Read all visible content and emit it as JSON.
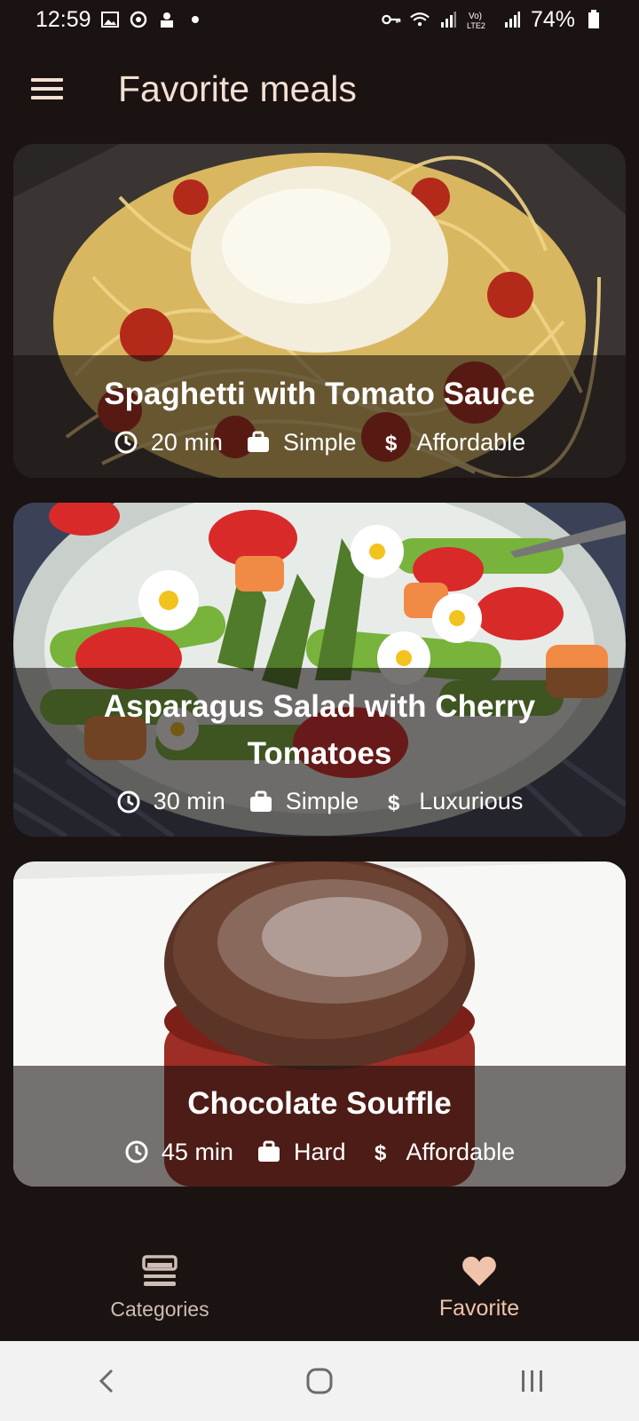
{
  "status_bar": {
    "time": "12:59",
    "battery": "74%"
  },
  "app_bar": {
    "title": "Favorite meals"
  },
  "meals": [
    {
      "title": "Spaghetti with Tomato Sauce",
      "duration": "20 min",
      "complexity": "Simple",
      "affordability": "Affordable"
    },
    {
      "title": "Asparagus Salad with Cherry Tomatoes",
      "duration": "30 min",
      "complexity": "Simple",
      "affordability": "Luxurious"
    },
    {
      "title": "Chocolate Souffle",
      "duration": "45 min",
      "complexity": "Hard",
      "affordability": "Affordable"
    }
  ],
  "bottom_nav": {
    "items": [
      {
        "label": "Categories",
        "icon": "dining-set-icon",
        "active": false
      },
      {
        "label": "Favorite",
        "icon": "heart-icon",
        "active": true
      }
    ]
  },
  "colors": {
    "background": "#1b1311",
    "title": "#f4dfd3",
    "active_nav": "#f0c3ad",
    "inactive_nav": "#cdbdb4",
    "system_nav_bg": "#f2f2f2"
  },
  "icons": [
    "menu-icon",
    "clock-icon",
    "briefcase-icon",
    "dollar-icon",
    "dining-set-icon",
    "heart-icon",
    "back-icon",
    "home-icon",
    "recents-icon"
  ]
}
